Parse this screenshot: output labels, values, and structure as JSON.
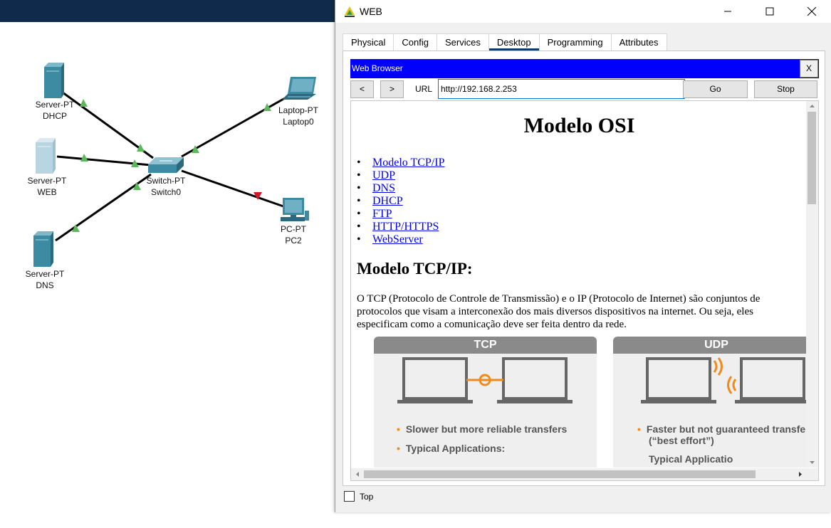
{
  "topology": {
    "devices": [
      {
        "model": "Server-PT",
        "name": "DHCP"
      },
      {
        "model": "Server-PT",
        "name": "WEB"
      },
      {
        "model": "Server-PT",
        "name": "DNS"
      },
      {
        "model": "Switch-PT",
        "name": "Switch0"
      },
      {
        "model": "Laptop-PT",
        "name": "Laptop0"
      },
      {
        "model": "PC-PT",
        "name": "PC2"
      }
    ],
    "link_up_color": "#5cb85c",
    "link_down_color": "#d0182a"
  },
  "window": {
    "title": "WEB",
    "tabs": [
      "Physical",
      "Config",
      "Services",
      "Desktop",
      "Programming",
      "Attributes"
    ],
    "active_tab": "Desktop",
    "top_checkbox_label": "Top",
    "top_checked": false
  },
  "browser": {
    "title": "Web Browser",
    "close_label": "X",
    "back_label": "<",
    "forward_label": ">",
    "url_label": "URL",
    "url_value": "http://192.168.2.253",
    "go_label": "Go",
    "stop_label": "Stop",
    "title_bar_color": "#0000ff"
  },
  "page": {
    "heading": "Modelo OSI",
    "links": [
      "Modelo TCP/IP",
      "UDP",
      "DNS",
      "DHCP",
      "FTP",
      "HTTP/HTTPS",
      "WebServer"
    ],
    "section_heading": "Modelo TCP/IP:",
    "paragraph": "O TCP (Protocolo de Controle de Transmissão) e o IP (Protocolo de Internet) são conjuntos de protocolos que visam a interconexão dos mais diversos dispositivos na internet. Ou seja, eles especificam como a comunicação deve ser feita dentro da rede.",
    "image": {
      "tcp": {
        "title": "TCP",
        "bullets": [
          "Slower but more reliable transfers",
          "Typical Applications:"
        ]
      },
      "udp": {
        "title": "UDP",
        "bullets": [
          "Faster but not guaranteed transfe",
          "(“best effort”)",
          "Typical Applicatio"
        ]
      }
    }
  }
}
